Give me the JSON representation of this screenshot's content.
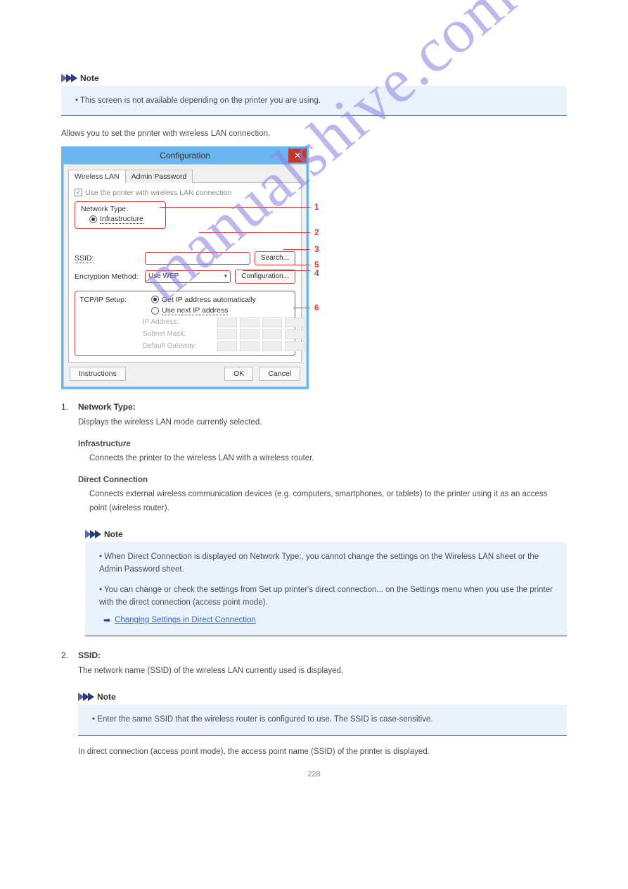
{
  "watermark": "manualshive.com",
  "page_number": "228",
  "note_top": {
    "heading": "Note",
    "bullet1": "• This screen is not available depending on the printer you are using."
  },
  "intro_text": "Allows you to set the printer with wireless LAN connection.",
  "dialog": {
    "title": "Configuration",
    "tabs": {
      "wireless": "Wireless LAN",
      "admin": "Admin Password"
    },
    "use_checkbox": "Use the printer with wireless LAN connection",
    "network_type_label": "Network Type:",
    "infra_label": "Infrastructure",
    "ssid_label": "SSID:",
    "ssid_value": "",
    "search_btn": "Search...",
    "enc_label": "Encryption Method:",
    "enc_value": "Use WEP",
    "config_btn": "Configuration...",
    "tcpip_label": "TCP/IP Setup:",
    "tcp_opt1": "Get IP address automatically",
    "tcp_opt2": "Use next IP address",
    "ip_addr_label": "IP Address:",
    "subnet_label": "Subnet Mask:",
    "gateway_label": "Default Gateway:",
    "instructions_btn": "Instructions",
    "ok_btn": "OK",
    "cancel_btn": "Cancel"
  },
  "callouts": {
    "c1": "1",
    "c2": "2",
    "c3": "3",
    "c4": "4",
    "c5": "5",
    "c6": "6"
  },
  "item1": {
    "num": "1.",
    "title": "Network Type:",
    "line1": "Displays the wireless LAN mode currently selected.",
    "infra_heading": "Infrastructure",
    "infra_body": "Connects the printer to the wireless LAN with a wireless router.",
    "direct_heading": "Direct Connection",
    "direct_body": "Connects external wireless communication devices (e.g. computers, smartphones, or tablets) to the printer using it as an access point (wireless router).",
    "note_heading": "Note",
    "note_bullet_a": "• When Direct Connection is displayed on Network Type:, you cannot change the settings on the Wireless LAN sheet or the Admin Password sheet.",
    "note_bullet_b": "• You can change or check the settings from Set up printer's direct connection... on the Settings menu when you use the printer with the direct connection (access point mode).",
    "note_link_text": "Changing Settings in Direct Connection"
  },
  "item2": {
    "num": "2.",
    "title": "SSID:",
    "line1": "The network name (SSID) of the wireless LAN currently used is displayed.",
    "note_heading": "Note",
    "note_bullet": "• Enter the same SSID that the wireless router is configured to use. The SSID is case-sensitive.",
    "line2": "In direct connection (access point mode), the access point name (SSID) of the printer is displayed."
  }
}
